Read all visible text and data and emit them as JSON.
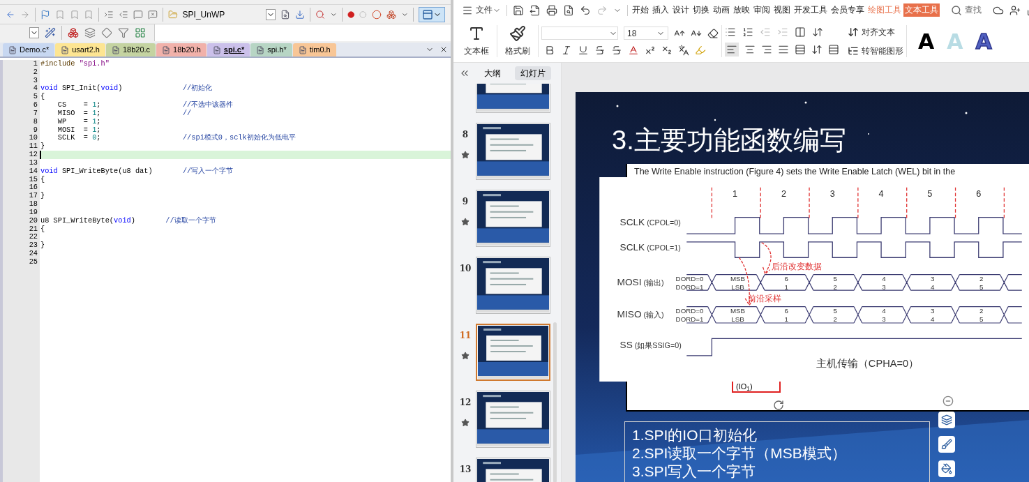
{
  "ide": {
    "target": "SPI_UnWP",
    "tabs": [
      {
        "label": "Demo.c*",
        "color": "#c7d7f1",
        "selected": false
      },
      {
        "label": "usart2.h",
        "color": "#fde592",
        "selected": false
      },
      {
        "label": "18b20.c",
        "color": "#c4d3a1",
        "selected": false
      },
      {
        "label": "18b20.h",
        "color": "#f1b1aa",
        "selected": false
      },
      {
        "label": "spi.c*",
        "color": "#cbc0ea",
        "selected": true
      },
      {
        "label": "spi.h*",
        "color": "#b7d5c4",
        "selected": false
      },
      {
        "label": "tim0.h",
        "color": "#f8c696",
        "selected": false
      }
    ],
    "lines": [
      {
        "n": "1",
        "current": false,
        "parts": [
          {
            "kind": "pre",
            "text": "#include "
          },
          {
            "kind": "string",
            "text": "\"spi.h\""
          }
        ]
      },
      {
        "n": "2",
        "current": false
      },
      {
        "n": "3",
        "current": false
      },
      {
        "n": "4",
        "current": false,
        "parts": [
          {
            "kind": "keyword",
            "text": "void"
          },
          {
            "kind": "plain",
            "text": " SPI_Init("
          },
          {
            "kind": "keyword",
            "text": "void"
          },
          {
            "kind": "plain",
            "text": ")              "
          },
          {
            "kind": "comment",
            "text": "//初始化"
          }
        ]
      },
      {
        "n": "5",
        "current": false,
        "parts": [
          {
            "kind": "plain",
            "text": "{"
          }
        ]
      },
      {
        "n": "6",
        "current": false,
        "parts": [
          {
            "kind": "plain",
            "text": "    CS    = "
          },
          {
            "kind": "number",
            "text": "1"
          },
          {
            "kind": "plain",
            "text": ";                   "
          },
          {
            "kind": "comment",
            "text": "//不选中该器件"
          }
        ]
      },
      {
        "n": "7",
        "current": false,
        "parts": [
          {
            "kind": "plain",
            "text": "    MISO  = "
          },
          {
            "kind": "number",
            "text": "1"
          },
          {
            "kind": "plain",
            "text": ";                   "
          },
          {
            "kind": "comment",
            "text": "//"
          }
        ]
      },
      {
        "n": "8",
        "current": false,
        "parts": [
          {
            "kind": "plain",
            "text": "    WP    = "
          },
          {
            "kind": "number",
            "text": "1"
          },
          {
            "kind": "plain",
            "text": ";"
          }
        ]
      },
      {
        "n": "9",
        "current": false,
        "parts": [
          {
            "kind": "plain",
            "text": "    MOSI  = "
          },
          {
            "kind": "number",
            "text": "1"
          },
          {
            "kind": "plain",
            "text": ";"
          }
        ]
      },
      {
        "n": "10",
        "current": false,
        "parts": [
          {
            "kind": "plain",
            "text": "    SCLK  = "
          },
          {
            "kind": "number",
            "text": "0"
          },
          {
            "kind": "plain",
            "text": ";                   "
          },
          {
            "kind": "comment",
            "text": "//spi模式0，sclk初始化为低电平"
          }
        ]
      },
      {
        "n": "11",
        "current": false,
        "parts": [
          {
            "kind": "plain",
            "text": "}"
          }
        ]
      },
      {
        "n": "12",
        "current": true
      },
      {
        "n": "13",
        "current": false
      },
      {
        "n": "14",
        "current": false,
        "parts": [
          {
            "kind": "keyword",
            "text": "void"
          },
          {
            "kind": "plain",
            "text": " SPI_WriteByte(u8 dat)       "
          },
          {
            "kind": "comment",
            "text": "//写入一个字节"
          }
        ]
      },
      {
        "n": "15",
        "current": false,
        "parts": [
          {
            "kind": "plain",
            "text": "{"
          }
        ]
      },
      {
        "n": "16",
        "current": false
      },
      {
        "n": "17",
        "current": false,
        "parts": [
          {
            "kind": "plain",
            "text": "}"
          }
        ]
      },
      {
        "n": "18",
        "current": false
      },
      {
        "n": "19",
        "current": false
      },
      {
        "n": "20",
        "current": false,
        "parts": [
          {
            "kind": "plain",
            "text": "u8 SPI_WriteByte("
          },
          {
            "kind": "keyword",
            "text": "void"
          },
          {
            "kind": "plain",
            "text": ")       "
          },
          {
            "kind": "comment",
            "text": "//读取一个字节"
          }
        ]
      },
      {
        "n": "21",
        "current": false,
        "parts": [
          {
            "kind": "plain",
            "text": "{"
          }
        ]
      },
      {
        "n": "22",
        "current": false
      },
      {
        "n": "23",
        "current": false,
        "parts": [
          {
            "kind": "plain",
            "text": "}"
          }
        ]
      },
      {
        "n": "24",
        "current": false
      },
      {
        "n": "25",
        "current": false
      }
    ]
  },
  "wps": {
    "menu": "文件",
    "tabs": [
      {
        "label": "开始",
        "kind": "normal",
        "selected": false
      },
      {
        "label": "插入",
        "kind": "normal",
        "selected": false
      },
      {
        "label": "设计",
        "kind": "normal",
        "selected": false
      },
      {
        "label": "切换",
        "kind": "normal",
        "selected": false
      },
      {
        "label": "动画",
        "kind": "normal",
        "selected": false
      },
      {
        "label": "放映",
        "kind": "normal",
        "selected": false
      },
      {
        "label": "审阅",
        "kind": "normal",
        "selected": false
      },
      {
        "label": "视图",
        "kind": "normal",
        "selected": false
      },
      {
        "label": "开发工具",
        "kind": "normal",
        "selected": false
      },
      {
        "label": "会员专享",
        "kind": "normal",
        "selected": false
      },
      {
        "label": "绘图工具",
        "kind": "contextual",
        "selected": false
      },
      {
        "label": "文本工具",
        "kind": "contextual",
        "selected": true
      }
    ],
    "search": "查找",
    "ribbon": {
      "textbox": "文本框",
      "format_painter": "格式刷",
      "font_size": "18",
      "align_text": "对齐文本",
      "smart_shape": "转智能图形",
      "styles": [
        "A",
        "A",
        "A"
      ]
    },
    "pane_tabs": [
      {
        "label": "大纲",
        "selected": false
      },
      {
        "label": "幻灯片",
        "selected": true
      }
    ],
    "thumbnails": [
      {
        "starred": false,
        "selected": false
      },
      {
        "number": "8",
        "starred": true,
        "selected": false
      },
      {
        "number": "9",
        "starred": true,
        "selected": false
      },
      {
        "number": "10",
        "starred": false,
        "selected": false
      },
      {
        "number": "11",
        "starred": true,
        "selected": true
      },
      {
        "number": "12",
        "starred": true,
        "selected": false
      },
      {
        "number": "13",
        "starred": false,
        "selected": false
      }
    ],
    "slide": {
      "title": "3.主要功能函数编写",
      "doc_text": "The Write Enable instruction (Figure 4) sets the Write Enable Latch (WEL) bit in the",
      "diagram": {
        "clocks": [
          "1",
          "2",
          "3",
          "4",
          "5",
          "6"
        ],
        "signals": [
          {
            "name": "SCLK",
            "note": "(CPOL=0)",
            "kind": "clock_low"
          },
          {
            "name": "SCLK",
            "note": "(CPOL=1)",
            "kind": "clock_high"
          },
          {
            "name": "MOSI",
            "note": "(输出)",
            "kind": "bus",
            "dord": [
              "DORD=0",
              "DORD=1"
            ],
            "cells": [
              [
                "MSB",
                "LSB"
              ],
              [
                "6",
                "1"
              ],
              [
                "5",
                "2"
              ],
              [
                "4",
                "3"
              ],
              [
                "3",
                "4"
              ],
              [
                "2",
                "5"
              ]
            ]
          },
          {
            "name": "MISO",
            "note": "(输入)",
            "kind": "bus",
            "dord": [
              "DORD=0",
              "DORD=1"
            ],
            "cells": [
              [
                "MSB",
                "LSB"
              ],
              [
                "6",
                "1"
              ],
              [
                "5",
                "2"
              ],
              [
                "4",
                "3"
              ],
              [
                "3",
                "4"
              ],
              [
                "2",
                "5"
              ]
            ]
          },
          {
            "name": "SS",
            "note": "(如果SSIG=0)",
            "kind": "select"
          }
        ],
        "annotations": [
          "后沿改变数据",
          "前沿采样"
        ],
        "caption": "主机传输（CPHA=0）"
      },
      "io_label": "(IO$_{1}$)",
      "bullets": [
        "1.SPI的IO口初始化",
        "2.SPI读取一个字节（MSB模式）",
        "3.SPI写入一个字节"
      ]
    }
  }
}
